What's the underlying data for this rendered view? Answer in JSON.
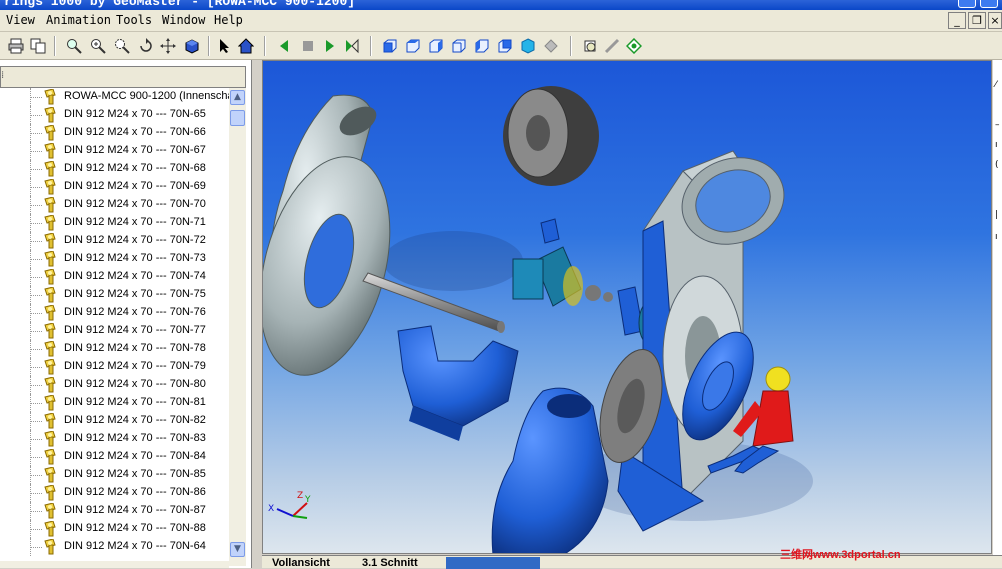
{
  "window": {
    "title": "rings 1000 by GeoMaster - [ROWA-MCC 900-1200]"
  },
  "menu": {
    "items": [
      "View",
      "Animation",
      "Tools",
      "Window",
      "Help"
    ]
  },
  "tree": {
    "items": [
      "ROWA-MCC 900-1200 (Innenscha",
      "DIN 912 M24 x 70 --- 70N-65",
      "DIN 912 M24 x 70 --- 70N-66",
      "DIN 912 M24 x 70 --- 70N-67",
      "DIN 912 M24 x 70 --- 70N-68",
      "DIN 912 M24 x 70 --- 70N-69",
      "DIN 912 M24 x 70 --- 70N-70",
      "DIN 912 M24 x 70 --- 70N-71",
      "DIN 912 M24 x 70 --- 70N-72",
      "DIN 912 M24 x 70 --- 70N-73",
      "DIN 912 M24 x 70 --- 70N-74",
      "DIN 912 M24 x 70 --- 70N-75",
      "DIN 912 M24 x 70 --- 70N-76",
      "DIN 912 M24 x 70 --- 70N-77",
      "DIN 912 M24 x 70 --- 70N-78",
      "DIN 912 M24 x 70 --- 70N-79",
      "DIN 912 M24 x 70 --- 70N-80",
      "DIN 912 M24 x 70 --- 70N-81",
      "DIN 912 M24 x 70 --- 70N-82",
      "DIN 912 M24 x 70 --- 70N-83",
      "DIN 912 M24 x 70 --- 70N-84",
      "DIN 912 M24 x 70 --- 70N-85",
      "DIN 912 M24 x 70 --- 70N-86",
      "DIN 912 M24 x 70 --- 70N-87",
      "DIN 912 M24 x 70 --- 70N-88",
      "DIN 912 M24 x 70 --- 70N-64"
    ]
  },
  "bottom_tabs": [
    "Vollansicht",
    "3.1 Schnitt",
    ""
  ],
  "watermark": "三维网www.3dportal.cn",
  "axis_labels": {
    "x": "X",
    "y": "Y",
    "z": "Z"
  },
  "colors": {
    "title_blue": "#0a47c8",
    "viewport_top": "#1c57d8",
    "part_blue": "#1f5fd6",
    "part_grey": "#9aa7a8",
    "accent_red": "#e0141e"
  }
}
